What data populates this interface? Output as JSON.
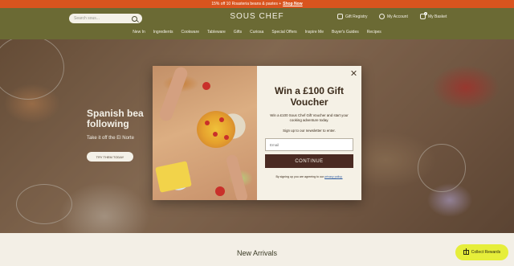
{
  "promo": {
    "text": "15% off 10 Roasteria beans & pastes +",
    "link": "Shop Now"
  },
  "header": {
    "search_placeholder": "Search sous...",
    "logo": "SOUS CHEF",
    "gift_registry": "Gift Registry",
    "my_account": "My Account",
    "my_basket": "My Basket",
    "basket_count": "0"
  },
  "nav": {
    "items": [
      "New In",
      "Ingredients",
      "Cookware",
      "Tableware",
      "Gifts",
      "Curiosa",
      "Special Offers",
      "Inspire Me",
      "Buyer's Guides",
      "Recipes"
    ]
  },
  "hero": {
    "title": "Spanish bea following",
    "subtitle": "Take it off the El Norte",
    "button": "TRY THEM TODAY"
  },
  "modal": {
    "title": "Win a £100 Gift Voucher",
    "description": "Win a £100 Sous Chef Gift Voucher and start your cooking adventure today.",
    "signup_text": "Sign up to our newsletter to enter.",
    "email_placeholder": "Email",
    "continue_label": "CONTINUE",
    "terms_text": "By signing up you are agreeing to our",
    "privacy_link": "privacy policy."
  },
  "section": {
    "new_arrivals": "New Arrivals"
  },
  "rewards": {
    "label": "Collect Rewards"
  }
}
